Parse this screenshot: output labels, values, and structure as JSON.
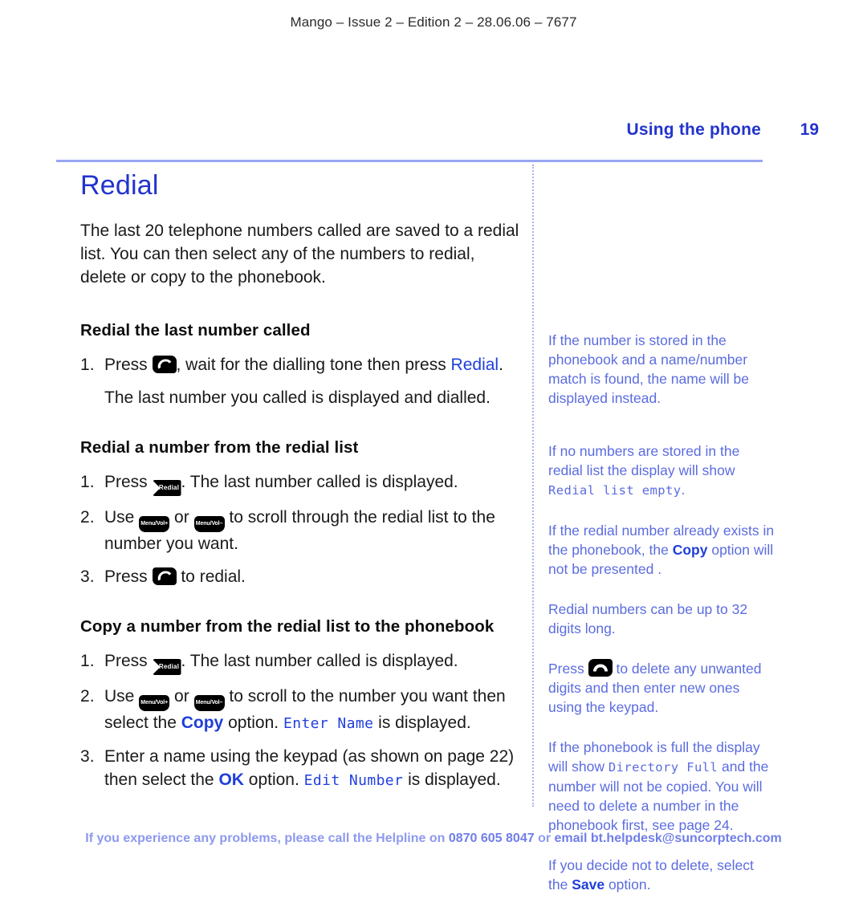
{
  "print_mark": "Mango – Issue 2 – Edition 2 – 28.06.06 – 7677",
  "running_head": {
    "title": "Using the phone",
    "page_number": "19"
  },
  "colors": {
    "heading_blue": "#2233cc",
    "inline_blue": "#1f3fd9",
    "note_blue": "#5b6ce0",
    "rule_blue": "#97a5f2",
    "footer_blue": "#8d99ee"
  },
  "main": {
    "title": "Redial",
    "intro": "The last 20 telephone numbers called are saved to a redial list. You can then select any of the numbers to redial, delete or copy to the phonebook.",
    "sections": [
      {
        "heading": "Redial the last number called",
        "steps": [
          {
            "parts": [
              {
                "type": "text",
                "value": "Press "
              },
              {
                "type": "key",
                "icon": "call-key-icon",
                "label": ""
              },
              {
                "type": "text",
                "value": ", wait for the dialling tone then press "
              },
              {
                "type": "blue",
                "value": "Redial"
              },
              {
                "type": "text",
                "value": "."
              }
            ]
          },
          {
            "continuation": true,
            "parts": [
              {
                "type": "text",
                "value": "The last number you called is displayed and dialled."
              }
            ]
          }
        ]
      },
      {
        "heading": "Redial a number from the redial list",
        "steps": [
          {
            "parts": [
              {
                "type": "text",
                "value": "Press "
              },
              {
                "type": "key",
                "icon": "redial-key-icon",
                "label": "Redial"
              },
              {
                "type": "text",
                "value": ". The last number called is displayed."
              }
            ]
          },
          {
            "parts": [
              {
                "type": "text",
                "value": "Use "
              },
              {
                "type": "key",
                "icon": "menu-vol-up-key-icon",
                "label": "Menu/Vol+"
              },
              {
                "type": "text",
                "value": " or "
              },
              {
                "type": "key",
                "icon": "menu-vol-down-key-icon",
                "label": "Menu/Vol–"
              },
              {
                "type": "text",
                "value": " to scroll through the redial list to the number you want."
              }
            ]
          },
          {
            "parts": [
              {
                "type": "text",
                "value": "Press "
              },
              {
                "type": "key",
                "icon": "call-key-icon",
                "label": ""
              },
              {
                "type": "text",
                "value": " to redial."
              }
            ]
          }
        ]
      },
      {
        "heading": "Copy a number from the redial list to the phonebook",
        "steps": [
          {
            "parts": [
              {
                "type": "text",
                "value": "Press "
              },
              {
                "type": "key",
                "icon": "redial-key-icon",
                "label": "Redial"
              },
              {
                "type": "text",
                "value": ". The last number called is displayed."
              }
            ]
          },
          {
            "parts": [
              {
                "type": "text",
                "value": "Use "
              },
              {
                "type": "key",
                "icon": "menu-vol-up-key-icon",
                "label": "Menu/Vol+"
              },
              {
                "type": "text",
                "value": " or "
              },
              {
                "type": "key",
                "icon": "menu-vol-down-key-icon",
                "label": "Menu/Vol–"
              },
              {
                "type": "text",
                "value": " to scroll to the number you want then select the "
              },
              {
                "type": "bold-blue",
                "value": "Copy"
              },
              {
                "type": "text",
                "value": " option. "
              },
              {
                "type": "lcd",
                "value": "Enter Name"
              },
              {
                "type": "text",
                "value": " is displayed."
              }
            ]
          },
          {
            "parts": [
              {
                "type": "text",
                "value": "Enter a name using the keypad (as shown on page 22) then select the "
              },
              {
                "type": "bold-blue",
                "value": "OK"
              },
              {
                "type": "text",
                "value": " option. "
              },
              {
                "type": "lcd",
                "value": "Edit Number"
              },
              {
                "type": "text",
                "value": " is displayed."
              }
            ]
          }
        ]
      }
    ]
  },
  "notes": [
    {
      "gap": "big",
      "parts": [
        {
          "type": "text",
          "value": "If the number is stored in the phonebook and a name/number match is found, the name will be displayed instead."
        }
      ]
    },
    {
      "parts": [
        {
          "type": "text",
          "value": "If no numbers are stored in the redial list the display will show "
        },
        {
          "type": "lcd",
          "value": "Redial list empty"
        },
        {
          "type": "text",
          "value": "."
        }
      ]
    },
    {
      "parts": [
        {
          "type": "text",
          "value": "If the redial number already exists in the phonebook, the "
        },
        {
          "type": "bold",
          "value": "Copy"
        },
        {
          "type": "text",
          "value": " option will not be presented ."
        }
      ]
    },
    {
      "parts": [
        {
          "type": "text",
          "value": "Redial numbers can be up to 32 digits long."
        }
      ]
    },
    {
      "parts": [
        {
          "type": "text",
          "value": "Press "
        },
        {
          "type": "key",
          "icon": "hangup-key-icon",
          "label": ""
        },
        {
          "type": "text",
          "value": " to delete any unwanted digits and then enter new ones using the keypad."
        }
      ]
    },
    {
      "parts": [
        {
          "type": "text",
          "value": "If the phonebook is full the display will show "
        },
        {
          "type": "lcd",
          "value": "Directory Full"
        },
        {
          "type": "text",
          "value": " and the number will not be copied. You will need to delete a number in the phonebook first, see page 24."
        }
      ]
    },
    {
      "parts": [
        {
          "type": "text",
          "value": "If you decide not to delete, select the "
        },
        {
          "type": "bold",
          "value": "Save"
        },
        {
          "type": "text",
          "value": " option."
        }
      ]
    }
  ],
  "footer": {
    "lead": "If you experience any problems, please call the Helpline on ",
    "phone": "0870 605 8047",
    "mid": " or ",
    "email": "email bt.helpdesk@suncorptech.com"
  }
}
